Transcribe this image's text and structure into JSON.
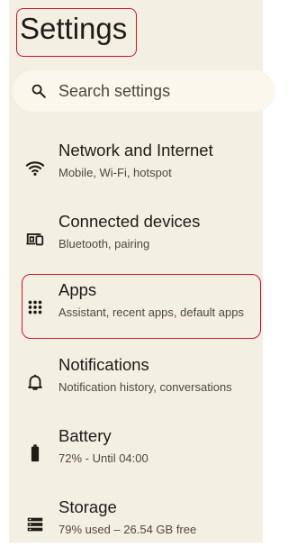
{
  "header": {
    "title": "Settings"
  },
  "search": {
    "placeholder": "Search settings",
    "icon": "search-icon"
  },
  "items": [
    {
      "title": "Network and Internet",
      "subtitle": "Mobile, Wi-Fi, hotspot",
      "icon": "wifi-icon"
    },
    {
      "title": "Connected devices",
      "subtitle": "Bluetooth, pairing",
      "icon": "devices-icon"
    },
    {
      "title": "Apps",
      "subtitle": "Assistant, recent apps, default apps",
      "icon": "apps-grid-icon"
    },
    {
      "title": "Notifications",
      "subtitle": "Notification history, conversations",
      "icon": "bell-icon"
    },
    {
      "title": "Battery",
      "subtitle": "72% - Until 04:00",
      "icon": "battery-icon"
    },
    {
      "title": "Storage",
      "subtitle": "79% used – 26.54 GB free",
      "icon": "storage-icon"
    }
  ],
  "colors": {
    "background": "#f4efe3",
    "search_background": "#fbf7ed",
    "text_primary": "#1f1b16",
    "text_secondary": "#50483c",
    "highlight_outline": "#d0142c"
  }
}
